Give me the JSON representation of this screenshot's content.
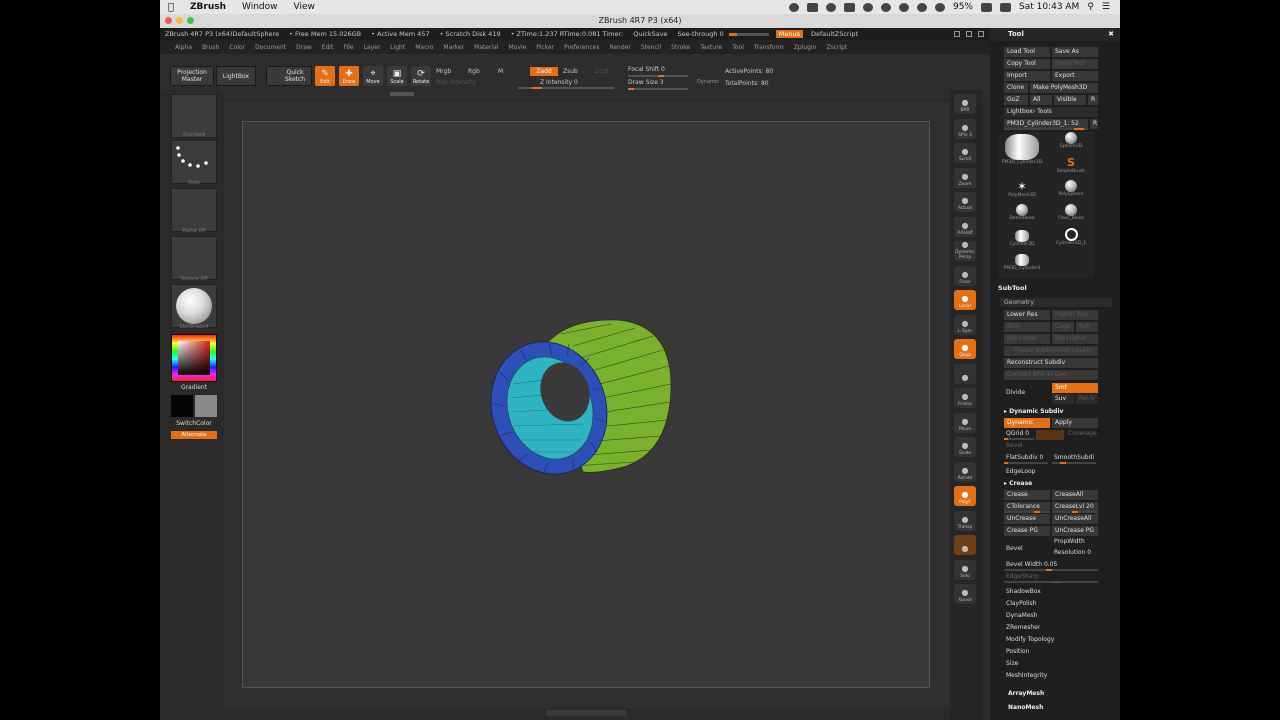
{
  "menubar": {
    "app_name": "ZBrush",
    "menu_window": "Window",
    "menu_view": "View",
    "battery": "95%",
    "clock": "Sat 10:43 AM"
  },
  "window_title": "ZBrush 4R7 P3 (x64)",
  "infobar": {
    "doc": "ZBrush 4R7 P3 (x64)DefaultSphere",
    "free_mem": "• Free Mem 15.026GB",
    "active_mem": "• Active Mem 457",
    "scratch": "• Scratch Disk 419",
    "timer": "• ZTime:1.237 RTime:0.081 Timer:",
    "quicksave": "QuickSave",
    "seethrough": "See-through 0",
    "menus": "Menus",
    "zscript": "DefaultZScript"
  },
  "menus": [
    "Alpha",
    "Brush",
    "Color",
    "Document",
    "Draw",
    "Edit",
    "File",
    "Layer",
    "Light",
    "Macro",
    "Marker",
    "Material",
    "Movie",
    "Picker",
    "Preferences",
    "Render",
    "Stencil",
    "Stroke",
    "Texture",
    "Tool",
    "Transform",
    "Zplugin",
    "Zscript"
  ],
  "toolbar": {
    "projection_master": "Projection Master",
    "lightbox": "LightBox",
    "quick_sketch": "Quick Sketch",
    "edit": "Edit",
    "draw": "Draw",
    "move": "Move",
    "scale": "Scale",
    "rotate": "Rotate",
    "mrgb": "Mrgb",
    "rgb": "Rgb",
    "m": "M",
    "rgb_intensity": "Rgb Intensity",
    "zadd": "Zadd",
    "zsub": "Zsub",
    "zcut": "Zcut",
    "z_intensity": "Z Intensity 0",
    "focal_shift": "Focal Shift 0",
    "draw_size": "Draw Size 3",
    "dynamic": "Dynamic",
    "active_points": "ActivePoints: 80",
    "total_points": "TotalPoints: 80"
  },
  "leftshelf": {
    "thumb1": "Standard",
    "thumb2": "Dots",
    "thumb3": "Alpha Off",
    "thumb4": "Texture Off",
    "thumb5": "SkinShade4",
    "gradient": "Gradient",
    "switch_color": "SwitchColor",
    "alternate": "Alternate"
  },
  "rightshelf": [
    "BPR",
    "SPix 3",
    "Scroll",
    "Zoom",
    "Actual",
    "AAHalf",
    "Dynamic Persp",
    "Floor",
    "Local",
    "L.Sym",
    "Qxyz",
    "",
    "Frame",
    "Move",
    "Scale",
    "Rotate",
    "PolyF",
    "Transp",
    "",
    "Solo",
    "Xpose"
  ],
  "toolpanel": {
    "title": "Tool",
    "load_tool": "Load Tool",
    "save_as": "Save As",
    "copy_tool": "Copy Tool",
    "paste_tool": "Paste Tool",
    "import": "Import",
    "export": "Export",
    "clone": "Clone",
    "make_polymesh": "Make PolyMesh3D",
    "goz": "GoZ",
    "all": "All",
    "visible": "Visible",
    "r": "R",
    "lightbox_tools": "Lightbox› Tools",
    "current_tool": "PM3D_Cylinder3D_1. 52",
    "tools": [
      {
        "name": "PM3D_Cylinder3D",
        "shape": "cylinder"
      },
      {
        "name": "Sphere3D",
        "shape": "sphere"
      },
      {
        "name": "SimpleBrush",
        "shape": "s-brush"
      },
      {
        "name": "PolyMesh3D",
        "shape": "star"
      },
      {
        "name": "PolySphere",
        "shape": "sphere"
      },
      {
        "name": "DemoHead",
        "shape": "head"
      },
      {
        "name": "Floor_Block",
        "shape": "sphere"
      },
      {
        "name": "Cylinder3D",
        "shape": "cylinder"
      },
      {
        "name": "Cylinder3D_1",
        "shape": "ring"
      },
      {
        "name": "PM3D_Cylinder3",
        "shape": "cylinder"
      }
    ],
    "subtool": "SubTool",
    "geometry": "Geometry",
    "lower_res": "Lower Res",
    "higher_res": "Higher Res",
    "sdiv": "SDiv",
    "cage": "Cage",
    "rstr": "Rstr",
    "del_lower": "Del Lower",
    "del_higher": "Del Higher",
    "freeze_subdiv": "Freeze SubDivision Levels",
    "reconstruct_subdiv": "Reconstruct Subdiv",
    "convert_bpr": "Convert BPR To Geo",
    "divide": "Divide",
    "smt": "Smt",
    "suv": "Suv",
    "reuv": "ReUV",
    "dynamic_subdiv": "Dynamic Subdiv",
    "dynamic": "Dynamic",
    "apply": "Apply",
    "qgrid": "QGrid 0",
    "coverage": "Coverage",
    "bevel_lbl": "Bevel",
    "flat_subdiv": "FlatSubdiv 0",
    "smooth_subdiv": "SmoothSubdi",
    "edge_loop": "EdgeLoop",
    "crease_sec": "Crease",
    "crease": "Crease",
    "crease_all": "CreaseAll",
    "ctolerance": "CTolerance",
    "crease_lvl": "CreaseLvl 20",
    "uncrease": "UnCrease",
    "uncrease_all": "UnCreaseAll",
    "crease_pg": "Crease PG",
    "uncrease_pg": "UnCrease PG",
    "bevel": "Bevel",
    "prop_width": "PropWidth",
    "resolution": "Resolution 0",
    "bevel_width": "Bevel Width 0.05",
    "edge_sharp": "EdgeSharp",
    "shadowbox": "ShadowBox",
    "claypolish": "ClayPolish",
    "dynamesh": "DynaMesh",
    "zremesher": "ZRemesher",
    "modify_topology": "Modify Topology",
    "position": "Position",
    "size": "Size",
    "mesh_integrity": "MeshIntegrity",
    "array_mesh": "ArrayMesh",
    "nano_mesh": "NanoMesh"
  },
  "colors": {
    "accent": "#e56f14",
    "cylinder_outer": "#7ab22e",
    "cylinder_rim": "#2e4fb8",
    "cylinder_inner": "#2fb5c2"
  }
}
